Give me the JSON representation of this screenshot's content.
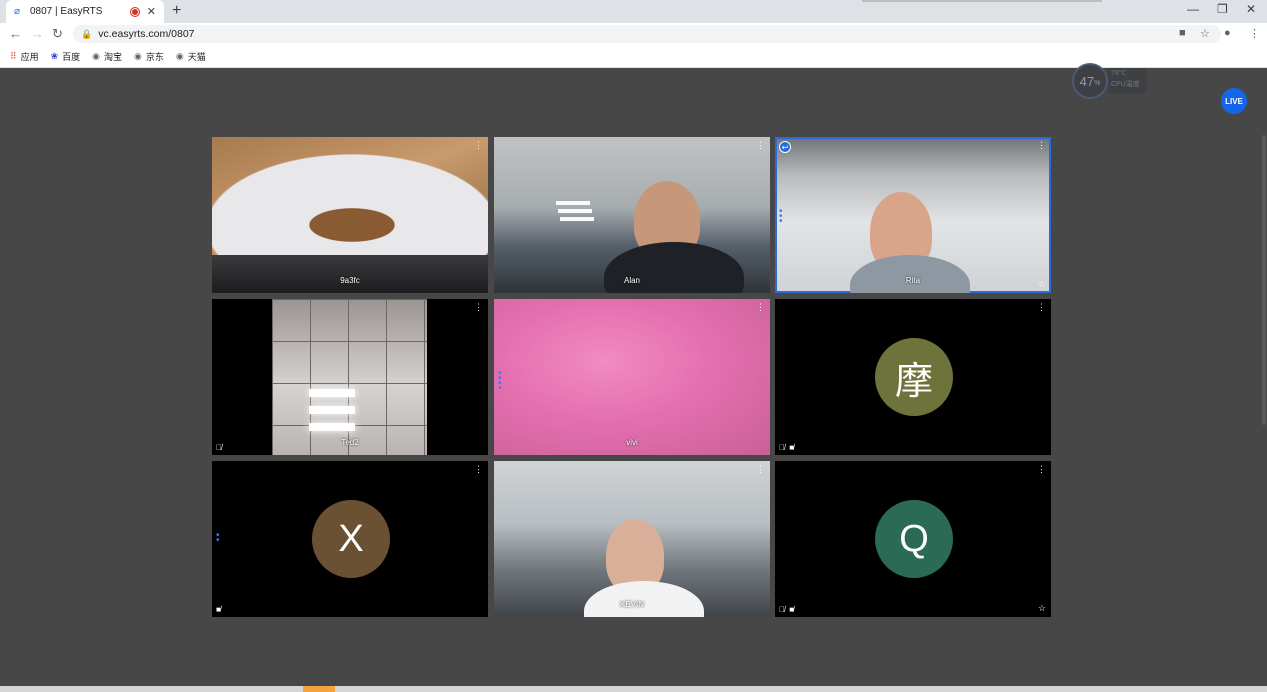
{
  "browser": {
    "tab_title": "0807 | EasyRTS",
    "url": "vc.easyrts.com/0807",
    "bookmarks": [
      "应用",
      "百度",
      "淘宝",
      "京东",
      "天猫"
    ]
  },
  "page": {
    "cpu_percent": "47",
    "cpu_unit": "%",
    "cpu_temp": "78°C",
    "cpu_label": "CPU温度",
    "live_label": "LIVE"
  },
  "participants": [
    {
      "name": "9a3fc"
    },
    {
      "name": "Alan"
    },
    {
      "name": "Rita"
    },
    {
      "name": "Ted2"
    },
    {
      "name": "vivi"
    },
    {
      "name": "",
      "avatar": "摩",
      "avatar_color": "#6e733c"
    },
    {
      "name": "",
      "avatar": "X",
      "avatar_color": "#6b5134"
    },
    {
      "name": "KEVIN"
    },
    {
      "name": "",
      "avatar": "Q",
      "avatar_color": "#2b6b55"
    }
  ],
  "colors": {
    "accent": "#1565e8",
    "page_bg": "#474747"
  }
}
